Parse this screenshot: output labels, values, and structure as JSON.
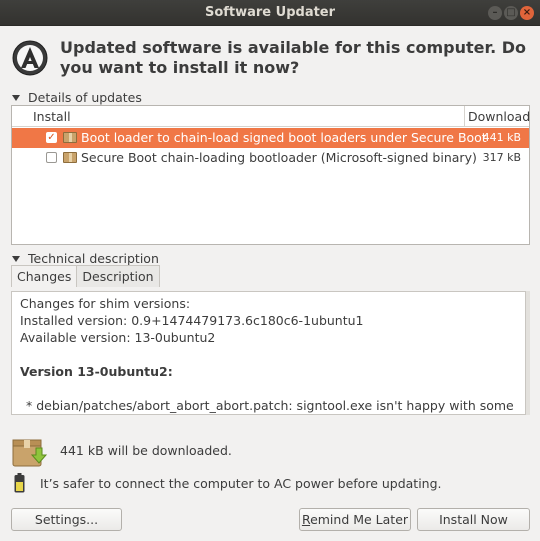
{
  "window": {
    "title": "Software Updater"
  },
  "header": {
    "message": "Updated software is available for this computer. Do you want to install it now?"
  },
  "details": {
    "expander_label": "Details of updates",
    "columns": {
      "install": "Install",
      "download": "Download"
    },
    "updates": [
      {
        "checked": true,
        "selected": true,
        "name": "Boot loader to chain-load signed boot loaders under Secure Boot",
        "size": "441 kB"
      },
      {
        "checked": false,
        "selected": false,
        "name": "Secure Boot chain-loading bootloader (Microsoft-signed binary)",
        "size": "317 kB"
      }
    ]
  },
  "technical": {
    "expander_label": "Technical description",
    "tabs": [
      "Changes",
      "Description"
    ],
    "active_tab": "Changes",
    "changes": {
      "line1": "Changes for shim versions:",
      "line2": "Installed version: 0.9+1474479173.6c180c6-1ubuntu1",
      "line3": "Available version: 13-0ubuntu2",
      "version_heading": "Version 13-0ubuntu2:",
      "bullet": "* debian/patches/abort_abort_abort.patch: signtool.exe isn't happy with some"
    }
  },
  "footer": {
    "download_info": "441 kB will be downloaded.",
    "power_warning": "It’s safer to connect the computer to AC power before updating."
  },
  "buttons": {
    "settings": "Settings...",
    "remind_prefix": "",
    "remind_mnemonic": "R",
    "remind_rest": "emind Me Later",
    "install": "Install Now"
  },
  "colors": {
    "selection": "#f07746",
    "titlebar": "#3c3b37",
    "close_button": "#e0643a"
  },
  "icons": {
    "app": "software-updater-icon",
    "download": "package-download-icon",
    "battery": "battery-icon"
  }
}
